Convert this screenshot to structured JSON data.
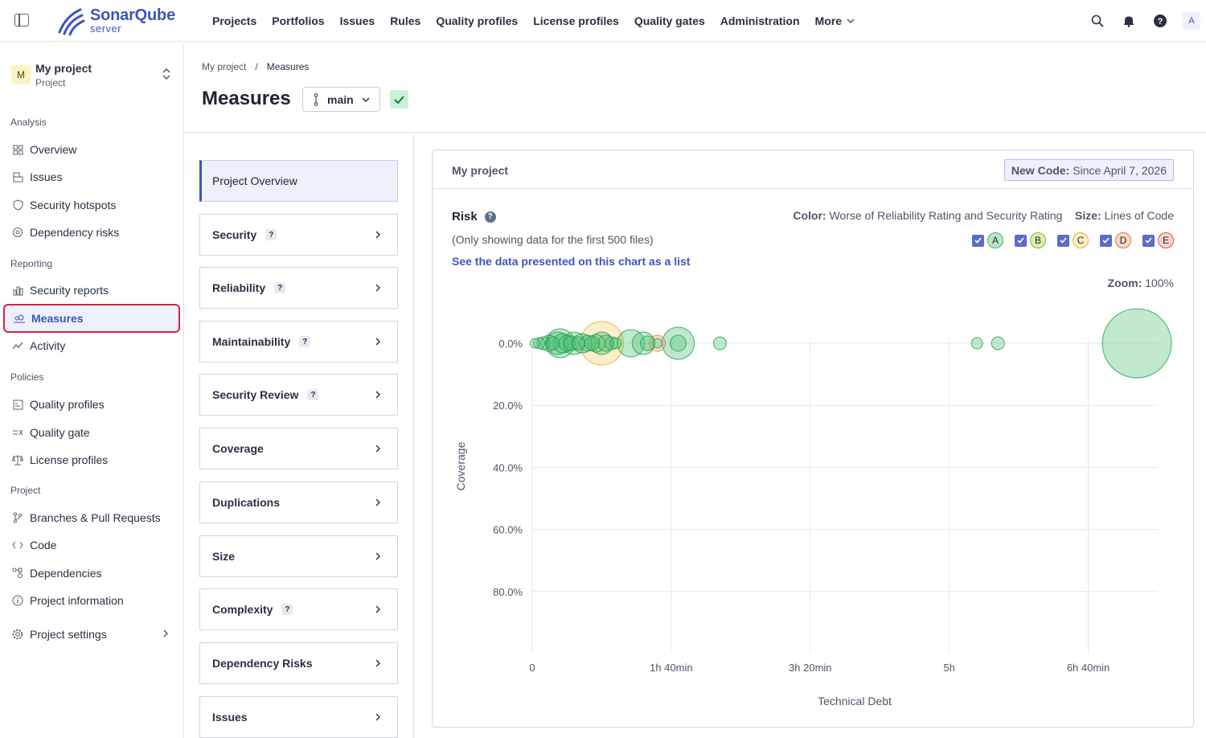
{
  "logo": {
    "name": "SonarQube",
    "sub": "server"
  },
  "nav": {
    "items": [
      "Projects",
      "Portfolios",
      "Issues",
      "Rules",
      "Quality profiles",
      "License profiles",
      "Quality gates",
      "Administration"
    ],
    "more": "More"
  },
  "user": {
    "avatar": "A"
  },
  "project": {
    "badge": "M",
    "name": "My project",
    "type": "Project"
  },
  "sidebar": {
    "sections": {
      "analysis": "Analysis",
      "reporting": "Reporting",
      "policies": "Policies",
      "project": "Project"
    },
    "items": {
      "overview": "Overview",
      "issues": "Issues",
      "hotspots": "Security hotspots",
      "dependency_risks": "Dependency risks",
      "security_reports": "Security reports",
      "measures": "Measures",
      "activity": "Activity",
      "quality_profiles": "Quality profiles",
      "quality_gate": "Quality gate",
      "license_profiles": "License profiles",
      "branches": "Branches & Pull Requests",
      "code": "Code",
      "dependencies": "Dependencies",
      "project_info": "Project information",
      "project_settings": "Project settings"
    }
  },
  "breadcrumb": {
    "project": "My project",
    "separator": "/",
    "current": "Measures"
  },
  "page": {
    "title": "Measures",
    "branch": "main"
  },
  "measures": {
    "overview": "Project Overview",
    "items": [
      {
        "label": "Security",
        "help": "?"
      },
      {
        "label": "Reliability",
        "help": "?"
      },
      {
        "label": "Maintainability",
        "help": "?"
      },
      {
        "label": "Security Review",
        "help": "?"
      },
      {
        "label": "Coverage"
      },
      {
        "label": "Duplications"
      },
      {
        "label": "Size"
      },
      {
        "label": "Complexity",
        "help": "?"
      },
      {
        "label": "Dependency Risks"
      },
      {
        "label": "Issues"
      }
    ]
  },
  "card": {
    "title": "My project",
    "new_code_label": "New Code:",
    "new_code_value": "Since April 7, 2026"
  },
  "risk": {
    "title": "Risk",
    "help": "?",
    "note": "(Only showing data for the first 500 files)",
    "link": "See the data presented on this chart as a list",
    "color_label": "Color:",
    "color_value": "Worse of Reliability Rating and Security Rating",
    "size_label": "Size:",
    "size_value": "Lines of Code",
    "zoom_label": "Zoom:",
    "zoom_value": "100%",
    "ratings": [
      {
        "letter": "A",
        "color": "#b8e6c8",
        "border": "#4caf6d",
        "checked": true
      },
      {
        "letter": "B",
        "color": "#d9efb0",
        "border": "#7fb83b",
        "checked": true
      },
      {
        "letter": "C",
        "color": "#fdefc4",
        "border": "#e2b23a",
        "checked": true
      },
      {
        "letter": "D",
        "color": "#fcd9c5",
        "border": "#e07a42",
        "checked": true
      },
      {
        "letter": "E",
        "color": "#fbd2d2",
        "border": "#d9534f",
        "checked": true
      }
    ]
  },
  "chart_data": {
    "type": "scatter",
    "xlabel": "Technical Debt",
    "ylabel": "Coverage",
    "x_unit": "minutes",
    "x_ticks": [
      {
        "value": 0,
        "label": "0"
      },
      {
        "value": 100,
        "label": "1h 40min"
      },
      {
        "value": 200,
        "label": "3h 20min"
      },
      {
        "value": 300,
        "label": "5h"
      },
      {
        "value": 400,
        "label": "6h 40min"
      }
    ],
    "y_ticks": [
      {
        "value": 0,
        "label": "0.0%"
      },
      {
        "value": 20,
        "label": "20.0%"
      },
      {
        "value": 40,
        "label": "40.0%"
      },
      {
        "value": 60,
        "label": "60.0%"
      },
      {
        "value": 80,
        "label": "80.0%"
      }
    ],
    "xlim": [
      0,
      450
    ],
    "ylim": [
      0,
      100
    ],
    "colors": {
      "A": {
        "fill": "#4bbf73",
        "stroke": "#1e9e4e"
      },
      "B": {
        "fill": "#a9d86e",
        "stroke": "#6fae2c"
      },
      "C": {
        "fill": "#f5cd6b",
        "stroke": "#e1a92a"
      },
      "D": {
        "fill": "#f3a27a",
        "stroke": "#e0683a"
      },
      "E": {
        "fill": "#ee8d8d",
        "stroke": "#d9534f"
      }
    },
    "points": [
      {
        "x": 2,
        "y": 0,
        "size": 6,
        "rating": "A"
      },
      {
        "x": 5,
        "y": 0,
        "size": 7,
        "rating": "A"
      },
      {
        "x": 8,
        "y": 0,
        "size": 8,
        "rating": "A"
      },
      {
        "x": 12,
        "y": 0,
        "size": 10,
        "rating": "A"
      },
      {
        "x": 15,
        "y": 0,
        "size": 8,
        "rating": "A"
      },
      {
        "x": 18,
        "y": 0,
        "size": 14,
        "rating": "A"
      },
      {
        "x": 20,
        "y": 0,
        "size": 18,
        "rating": "A"
      },
      {
        "x": 22,
        "y": 0,
        "size": 12,
        "rating": "A"
      },
      {
        "x": 25,
        "y": 0,
        "size": 10,
        "rating": "A"
      },
      {
        "x": 28,
        "y": 0,
        "size": 9,
        "rating": "A"
      },
      {
        "x": 30,
        "y": 0,
        "size": 14,
        "rating": "A"
      },
      {
        "x": 33,
        "y": 0,
        "size": 8,
        "rating": "A"
      },
      {
        "x": 36,
        "y": 0,
        "size": 12,
        "rating": "A"
      },
      {
        "x": 40,
        "y": 0,
        "size": 10,
        "rating": "A"
      },
      {
        "x": 43,
        "y": 0,
        "size": 9,
        "rating": "A"
      },
      {
        "x": 46,
        "y": 0,
        "size": 11,
        "rating": "A"
      },
      {
        "x": 50,
        "y": 0,
        "size": 27,
        "rating": "C"
      },
      {
        "x": 50,
        "y": 0,
        "size": 14,
        "rating": "A"
      },
      {
        "x": 53,
        "y": 0,
        "size": 10,
        "rating": "A"
      },
      {
        "x": 57,
        "y": 0,
        "size": 8,
        "rating": "A"
      },
      {
        "x": 60,
        "y": 0,
        "size": 7,
        "rating": "A"
      },
      {
        "x": 71,
        "y": 0,
        "size": 17,
        "rating": "A"
      },
      {
        "x": 80,
        "y": 0,
        "size": 14,
        "rating": "A"
      },
      {
        "x": 83,
        "y": 0,
        "size": 9,
        "rating": "A"
      },
      {
        "x": 90,
        "y": 0,
        "size": 10,
        "rating": "D"
      },
      {
        "x": 90,
        "y": 0,
        "size": 6,
        "rating": "A"
      },
      {
        "x": 105,
        "y": 0,
        "size": 20,
        "rating": "A"
      },
      {
        "x": 105,
        "y": 0,
        "size": 10,
        "rating": "A"
      },
      {
        "x": 135,
        "y": 0,
        "size": 8,
        "rating": "A"
      },
      {
        "x": 320,
        "y": 0,
        "size": 7,
        "rating": "A"
      },
      {
        "x": 335,
        "y": 0,
        "size": 8,
        "rating": "A"
      },
      {
        "x": 435,
        "y": 0,
        "size": 43,
        "rating": "A"
      }
    ]
  }
}
